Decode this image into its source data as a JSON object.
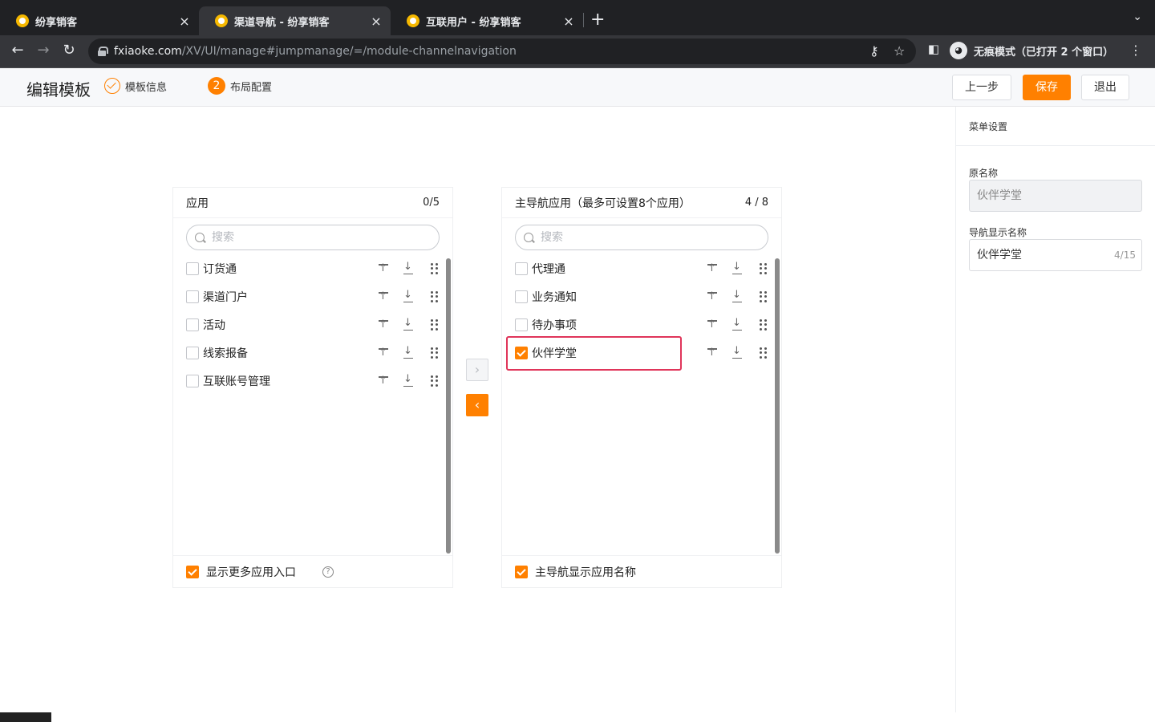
{
  "browser": {
    "tabs": [
      {
        "title": "纷享销客",
        "active": false
      },
      {
        "title": "渠道导航 - 纷享销客",
        "active": true
      },
      {
        "title": "互联用户 - 纷享销客",
        "active": false
      }
    ],
    "new_tab_icon": "plus-icon",
    "tab_close_glyph": "×",
    "url_host": "fxiaoke.com",
    "url_path": "/XV/UI/manage#jumpmanage/=/module-channelnavigation",
    "incognito_label": "无痕模式（已打开 2 个窗口）"
  },
  "header": {
    "title": "编辑模板",
    "steps": [
      {
        "label": "模板信息",
        "state": "done"
      },
      {
        "number": "2",
        "label": "布局配置",
        "state": "current"
      }
    ],
    "buttons": {
      "prev": "上一步",
      "save": "保存",
      "exit": "退出"
    },
    "accent_color": "#ff8000"
  },
  "left_panel": {
    "title": "应用",
    "count": "0/5",
    "search_placeholder": "搜索",
    "items": [
      {
        "label": "订货通",
        "checked": false
      },
      {
        "label": "渠道门户",
        "checked": false
      },
      {
        "label": "活动",
        "checked": false
      },
      {
        "label": "线索报备",
        "checked": false
      },
      {
        "label": "互联账号管理",
        "checked": false
      }
    ],
    "footer_label": "显示更多应用入口",
    "footer_checked": true
  },
  "right_panel": {
    "title": "主导航应用（最多可设置8个应用）",
    "count": "4 / 8",
    "search_placeholder": "搜索",
    "items": [
      {
        "label": "代理通",
        "checked": false
      },
      {
        "label": "业务通知",
        "checked": false
      },
      {
        "label": "待办事项",
        "checked": false
      },
      {
        "label": "伙伴学堂",
        "checked": true
      }
    ],
    "footer_label": "主导航显示应用名称",
    "footer_checked": true
  },
  "transfer": {
    "to_right_glyph": "›",
    "to_left_glyph": "‹"
  },
  "settings": {
    "title": "菜单设置",
    "original_name_label": "原名称",
    "original_name_value": "伙伴学堂",
    "display_name_label": "导航显示名称",
    "display_name_value": "伙伴学堂",
    "display_name_counter": "4/15"
  }
}
